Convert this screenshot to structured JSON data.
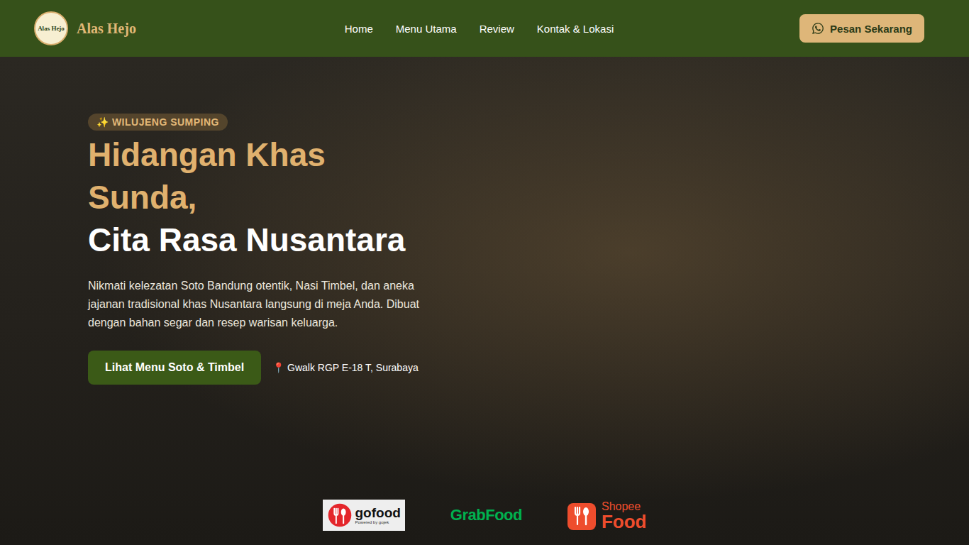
{
  "header": {
    "logo_text": "Alas Hejo",
    "brand": "Alas Hejo",
    "nav": [
      {
        "label": "Home"
      },
      {
        "label": "Menu Utama"
      },
      {
        "label": "Review"
      },
      {
        "label": "Kontak & Lokasi"
      }
    ],
    "cta": "Pesan Sekarang"
  },
  "hero": {
    "badge": "✨ WILUJENG SUMPING",
    "title_highlight": "Hidangan Khas Sunda,",
    "title_rest": "Cita Rasa Nusantara",
    "description": "Nikmati kelezatan Soto Bandung otentik, Nasi Timbel, dan aneka jajanan tradisional khas Nusantara langsung di meja Anda. Dibuat dengan bahan segar dan resep warisan keluarga.",
    "button": "Lihat Menu Soto & Timbel",
    "location_icon": "📍",
    "location": "Gwalk RGP E-18 T, Surabaya"
  },
  "delivery": [
    {
      "kind": "gofood",
      "lines": [
        "gofood",
        "Powered by gojek"
      ],
      "color": "#e4262b"
    },
    {
      "kind": "grabfood",
      "lines": [
        "GrabFood"
      ],
      "color": "#00b14f"
    },
    {
      "kind": "shopeefood",
      "lines": [
        "Shopee",
        "Food"
      ],
      "color": "#ee4d2d"
    }
  ]
}
